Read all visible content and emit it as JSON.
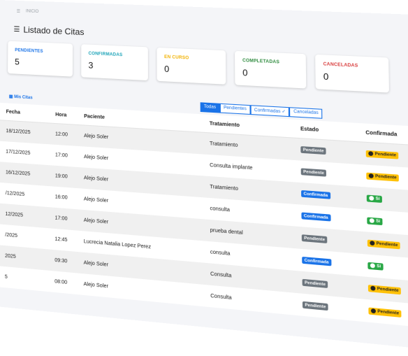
{
  "topbar": {
    "menu_icon": "hamburger-icon",
    "crumb": "INICIO"
  },
  "header": {
    "title_icon": "list-icon",
    "title": "Listado de Citas"
  },
  "cards": [
    {
      "label": "PENDIENTES",
      "value": "5"
    },
    {
      "label": "CONFIRMADAS",
      "value": "3"
    },
    {
      "label": "EN CURSO",
      "value": "0"
    },
    {
      "label": "COMPLETADAS",
      "value": "0"
    },
    {
      "label": "CANCELADAS",
      "value": "0"
    }
  ],
  "toolbar": {
    "mis_citas": "Mis Citas",
    "tabs": [
      "Todas",
      "Pendientes",
      "Confirmadas ✓",
      "Canceladas"
    ],
    "active_tab": "Todas"
  },
  "table": {
    "headers": [
      "Fecha",
      "Hora",
      "Paciente",
      "Tratamiento",
      "Estado",
      "Confirmada"
    ],
    "rows": [
      {
        "fecha": "18/12/2025",
        "hora": "12:00",
        "paciente": "Alejo Soler",
        "tratamiento": "Tratamiento",
        "estado": "Pendiente",
        "confirmada": "Pendiente"
      },
      {
        "fecha": "17/12/2025",
        "hora": "17:00",
        "paciente": "Alejo Soler",
        "tratamiento": "Consulta implante",
        "estado": "Pendiente",
        "confirmada": "Pendiente"
      },
      {
        "fecha": "16/12/2025",
        "hora": "19:00",
        "paciente": "Alejo Soler",
        "tratamiento": "Tratamiento",
        "estado": "Confirmada",
        "confirmada": "Sí"
      },
      {
        "fecha": "/12/2025",
        "hora": "16:00",
        "paciente": "Alejo Soler",
        "tratamiento": "consulta",
        "estado": "Confirmada",
        "confirmada": "Sí"
      },
      {
        "fecha": "12/2025",
        "hora": "17:00",
        "paciente": "Alejo Soler",
        "tratamiento": "prueba dental",
        "estado": "Pendiente",
        "confirmada": "Pendiente"
      },
      {
        "fecha": "/2025",
        "hora": "12:45",
        "paciente": "Lucrecia Natalia Lopez Perez",
        "tratamiento": "consulta",
        "estado": "Confirmada",
        "confirmada": "Sí"
      },
      {
        "fecha": "2025",
        "hora": "09:30",
        "paciente": "Alejo Soler",
        "tratamiento": "Consulta",
        "estado": "Pendiente",
        "confirmada": "Pendiente"
      },
      {
        "fecha": "5",
        "hora": "08:00",
        "paciente": "Alejo Soler",
        "tratamiento": "Consulta",
        "estado": "Pendiente",
        "confirmada": "Pendiente"
      }
    ]
  },
  "colors": {
    "primary": "#1a73e8",
    "pendiente": "#6c757d",
    "confirmada": "#1a73e8",
    "warning": "#ffc107",
    "success": "#28a745"
  }
}
